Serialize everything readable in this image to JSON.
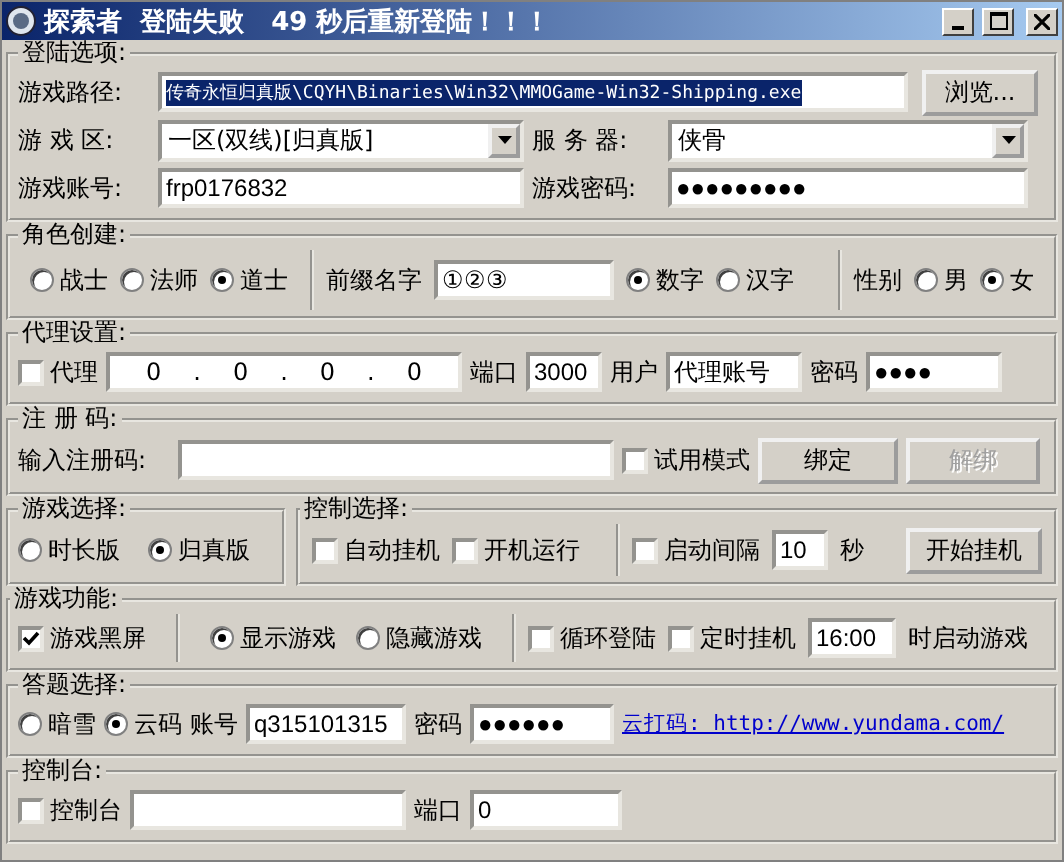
{
  "window": {
    "title": "探索者  登陆失败   49 秒后重新登陆！！！"
  },
  "login": {
    "legend": "登陆选项:",
    "path_label": "游戏路径:",
    "path_value": "传奇永恒归真版\\CQYH\\Binaries\\Win32\\MMOGame-Win32-Shipping.exe",
    "browse": "浏览...",
    "zone_label": "游 戏 区:",
    "zone_value": "一区(双线)[归真版]",
    "server_label": "服 务 器:",
    "server_value": "侠骨",
    "account_label": "游戏账号:",
    "account_value": "frp0176832",
    "password_label": "游戏密码:",
    "password_value": "●●●●●●●●●"
  },
  "role": {
    "legend": "角色创建:",
    "classes": [
      {
        "label": "战士",
        "selected": false
      },
      {
        "label": "法师",
        "selected": false
      },
      {
        "label": "道士",
        "selected": true
      }
    ],
    "prefix_label": "前缀名字",
    "prefix_value": "①②③",
    "prefix_types": [
      {
        "label": "数字",
        "selected": true
      },
      {
        "label": "汉字",
        "selected": false
      }
    ],
    "gender_label": "性别",
    "genders": [
      {
        "label": "男",
        "selected": false
      },
      {
        "label": "女",
        "selected": true
      }
    ]
  },
  "proxy": {
    "legend": "代理设置:",
    "enabled": {
      "label": "代理",
      "checked": false
    },
    "ip": {
      "octets": [
        "0",
        "0",
        "0",
        "0"
      ],
      "separator": "."
    },
    "port_label": "端口",
    "port_value": "3000",
    "user_label": "用户",
    "user_value": "代理账号",
    "password_label": "密码",
    "password_value": "●●●●"
  },
  "register": {
    "legend": "注 册 码:",
    "input_label": "输入注册码:",
    "trial": {
      "label": "试用模式",
      "checked": false
    },
    "buttons": [
      {
        "label": "绑定",
        "disabled": false
      },
      {
        "label": "解绑",
        "disabled": true
      }
    ]
  },
  "game_select": {
    "legend": "游戏选择:",
    "options": [
      {
        "label": "时长版",
        "selected": false
      },
      {
        "label": "归真版",
        "selected": true
      }
    ]
  },
  "control": {
    "legend": "控制选择:",
    "options": [
      {
        "label": "自动挂机",
        "checked": false
      },
      {
        "label": "开机运行",
        "checked": false
      }
    ],
    "interval": {
      "label": "启动间隔",
      "checked": false,
      "value": "10",
      "unit": "秒"
    },
    "start_button": "开始挂机"
  },
  "features": {
    "legend": "游戏功能:",
    "black_screen": {
      "label": "游戏黑屏",
      "checked": true
    },
    "display": [
      {
        "label": "显示游戏",
        "selected": true
      },
      {
        "label": "隐藏游戏",
        "selected": false
      }
    ],
    "loop_login": {
      "label": "循环登陆",
      "checked": false
    },
    "timed": {
      "label": "定时挂机",
      "checked": false,
      "value": "16:00",
      "suffix": "时启动游戏"
    }
  },
  "captcha": {
    "legend": "答题选择:",
    "options": [
      {
        "label": "暗雪",
        "selected": false
      },
      {
        "label": "云码",
        "selected": true
      }
    ],
    "account_label": "账号",
    "account_value": "q315101315",
    "password_label": "密码",
    "password_value": "●●●●●●",
    "link": "云打码: http://www.yundama.com/"
  },
  "console": {
    "legend": "控制台:",
    "enabled": {
      "label": "控制台",
      "checked": false
    },
    "port_label": "端口",
    "port_value": "0"
  }
}
